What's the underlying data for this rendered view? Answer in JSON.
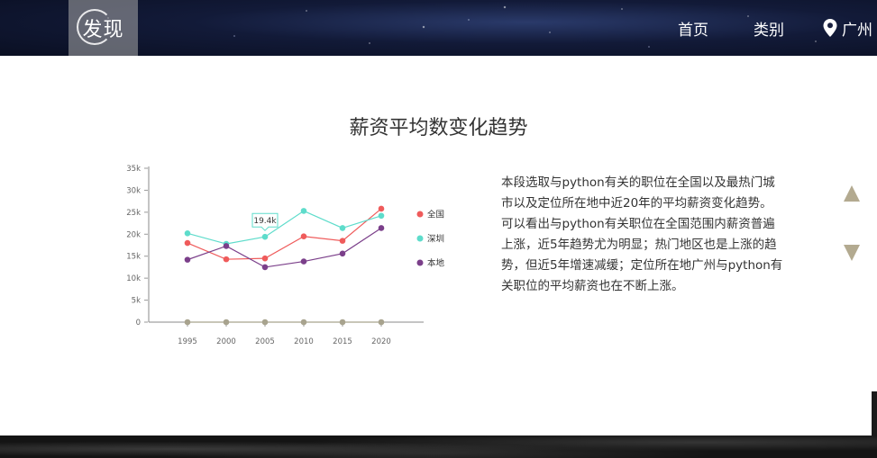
{
  "header": {
    "logo_text": "发现",
    "nav_home": "首页",
    "nav_category": "类别",
    "nav_city": "广州"
  },
  "section_title": "薪资平均数变化趋势",
  "description": [
    "本段选取与python有关的职位在全国以及最热门城市以及定位所在地中近20年的平均薪资变化趋势。",
    "可以看出与python有关职位在全国范围内薪资普遍上涨，近5年趋势尤为明显；热门地区也是上涨的趋势，但近5年增速减缓；定位所在地广州与python有关职位的平均薪资也在不断上涨。"
  ],
  "icons": {
    "location": "map-pin-icon",
    "up": "triangle-up-icon",
    "down": "triangle-down-icon"
  },
  "chart_data": {
    "type": "line",
    "x": [
      "1995",
      "2000",
      "2005",
      "2010",
      "2015",
      "2020"
    ],
    "y_ticks": [
      "0",
      "5k",
      "10k",
      "15k",
      "20k",
      "25k",
      "30k",
      "35k"
    ],
    "ylim": [
      0,
      35000
    ],
    "grid": false,
    "legend_position": "right",
    "series": [
      {
        "name": "全国",
        "color": "#ef5b5b",
        "values": [
          18000,
          14300,
          14500,
          19500,
          18500,
          25800
        ]
      },
      {
        "name": "深圳",
        "color": "#5edccb",
        "values": [
          20200,
          17800,
          19400,
          25300,
          21400,
          24200
        ]
      },
      {
        "name": "本地",
        "color": "#7b3f8a",
        "values": [
          14200,
          17300,
          12500,
          13800,
          15600,
          21400
        ]
      },
      {
        "name": "",
        "color": "#a8a38e",
        "values": [
          0,
          0,
          0,
          0,
          0,
          0
        ]
      }
    ],
    "tooltip": {
      "label": "19.4k",
      "series_index": 1,
      "point_index": 2
    }
  }
}
